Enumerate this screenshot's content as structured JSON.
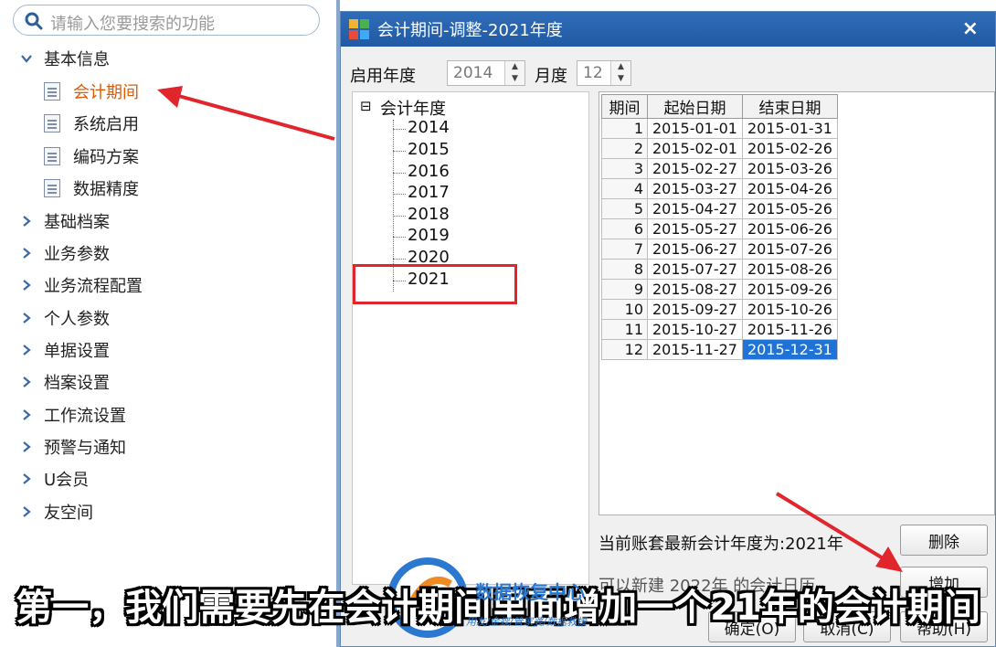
{
  "search": {
    "placeholder": "请输入您要搜索的功能"
  },
  "nav": {
    "basic_info": "基本信息",
    "sub_items": [
      "会计期间",
      "系统启用",
      "编码方案",
      "数据精度"
    ],
    "groups": [
      "基础档案",
      "业务参数",
      "业务流程配置",
      "个人参数",
      "单据设置",
      "档案设置",
      "工作流设置",
      "预警与通知",
      "U会员",
      "友空间"
    ]
  },
  "dialog": {
    "title": "会计期间-调整-2021年度",
    "close": "×",
    "start_year_label": "启用年度",
    "start_year_value": "2014",
    "month_label": "月度",
    "month_value": "12",
    "tree_root": "会计年度",
    "years": [
      "2014",
      "2015",
      "2016",
      "2017",
      "2018",
      "2019",
      "2020",
      "2021"
    ],
    "table_headers": [
      "期间",
      "起始日期",
      "结束日期"
    ],
    "rows": [
      [
        "1",
        "2015-01-01",
        "2015-01-31"
      ],
      [
        "2",
        "2015-02-01",
        "2015-02-26"
      ],
      [
        "3",
        "2015-02-27",
        "2015-03-26"
      ],
      [
        "4",
        "2015-03-27",
        "2015-04-26"
      ],
      [
        "5",
        "2015-04-27",
        "2015-05-26"
      ],
      [
        "6",
        "2015-05-27",
        "2015-06-26"
      ],
      [
        "7",
        "2015-06-27",
        "2015-07-26"
      ],
      [
        "8",
        "2015-07-27",
        "2015-08-26"
      ],
      [
        "9",
        "2015-08-27",
        "2015-09-26"
      ],
      [
        "10",
        "2015-09-27",
        "2015-10-26"
      ],
      [
        "11",
        "2015-10-27",
        "2015-11-26"
      ],
      [
        "12",
        "2015-11-27",
        "2015-12-31"
      ]
    ],
    "status": "当前账套最新会计年度为:2021年",
    "note": "可以新建 2022年 的会计日历",
    "delete_btn": "删除",
    "add_btn": "增加",
    "ok_btn": "确定(O)",
    "cancel_btn": "取消(C)",
    "help_btn": "帮助(H)"
  },
  "subtitle": "第一，我们需要先在会计期间里面增加一个21年的会计期间",
  "watermark": {
    "title": "数据恢复中心",
    "subtitle": "用友/金蝶/管家婆/数据救援"
  },
  "colors": {
    "accent": "#215aa4",
    "highlight": "#e05a00",
    "selection": "#1f73d6",
    "annotation": "#e0262c"
  }
}
